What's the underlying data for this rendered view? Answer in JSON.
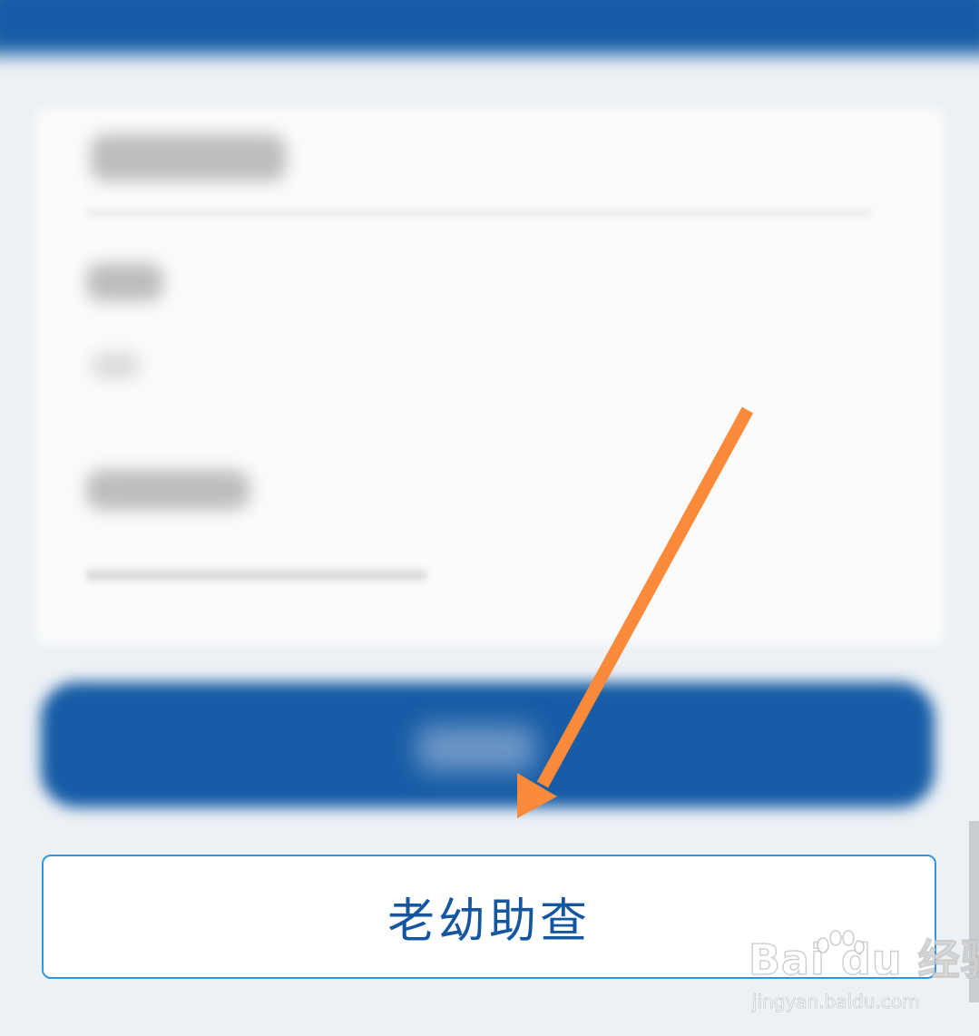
{
  "elder_child_check_button": {
    "label": "老幼助查"
  },
  "watermark": {
    "logo_text": "Bai  du 经验",
    "url": "jingyan.baidu.com"
  },
  "colors": {
    "brand_blue": "#165ca6",
    "outline_blue": "#3594dc",
    "label_blue": "#15579f",
    "arrow_orange": "#fb8a3b",
    "background": "#ecf1f5"
  },
  "annotation": {
    "arrow_icon": "orange-annotation-arrow-icon"
  }
}
